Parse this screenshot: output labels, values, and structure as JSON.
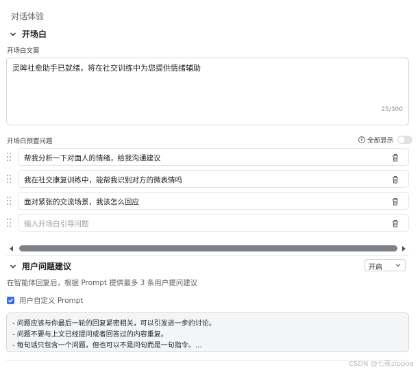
{
  "section": {
    "title": "对话体验"
  },
  "opening": {
    "group_title": "开场白",
    "text_label": "开场白文案",
    "text_value": "灵眸社愈助手已就绪，将在社交训练中为您提供情绪辅助",
    "counter": "25/300",
    "preset_label": "开场白预置问题",
    "show_all_label": "全部显示",
    "questions": [
      {
        "text": "帮我分析一下对面人的情绪，给我沟通建议"
      },
      {
        "text": "我在社交康复训练中，能帮我识别对方的微表情吗"
      },
      {
        "text": "面对紧张的交流场景，我该怎么回应"
      }
    ],
    "new_question_placeholder": "输入开场白引导问题"
  },
  "suggestions": {
    "group_title": "用户问题建议",
    "select_value": "开启",
    "description": "在智能体回复后，根据 Prompt 提供最多 3 条用户提问建议",
    "custom_prompt_label": "用户自定义 Prompt",
    "custom_prompt_checked": true,
    "prompt_lines": [
      "- 问题应该与你最后一轮的回复紧密相关，可以引发进一步的讨论。",
      "- 问题不要与上文已经提问或者回答过的内容重复。",
      "- 每句话只包含一个问题，但也可以不是问句而是一句指令。…"
    ]
  },
  "watermark": "CSDN @七夜zippoe",
  "colors": {
    "accent": "#3a6ee8",
    "scroll_thumb": "#7d8085"
  }
}
